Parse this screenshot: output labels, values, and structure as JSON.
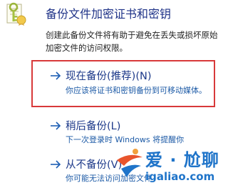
{
  "header": {
    "title": "备份文件加密证书和密钥",
    "icon": "certificate-key-icon"
  },
  "description": {
    "line1": "创建此备份文件将有助于避免在丢失或损坏原始",
    "line2": "加密文件的访问权限。"
  },
  "options": [
    {
      "title": "现在备份(推荐)(N)",
      "subtitle": "你应该将证书和密钥备份到可移动媒体。",
      "highlighted": true
    },
    {
      "title": "稍后备份(L)",
      "subtitle": "下一次登录时 Windows 将提醒你"
    },
    {
      "title": "从不备份(V)",
      "subtitle": "你可能无法访问加密文件"
    }
  ],
  "watermark": {
    "text": "爱 · 尬聊",
    "url": "igaliao.com"
  },
  "colors": {
    "title": "#1e3287",
    "option_title": "#1e3a8a",
    "option_sub": "#1c5aa6",
    "highlight_border": "#d8393a",
    "watermark": "#1f74c9"
  }
}
